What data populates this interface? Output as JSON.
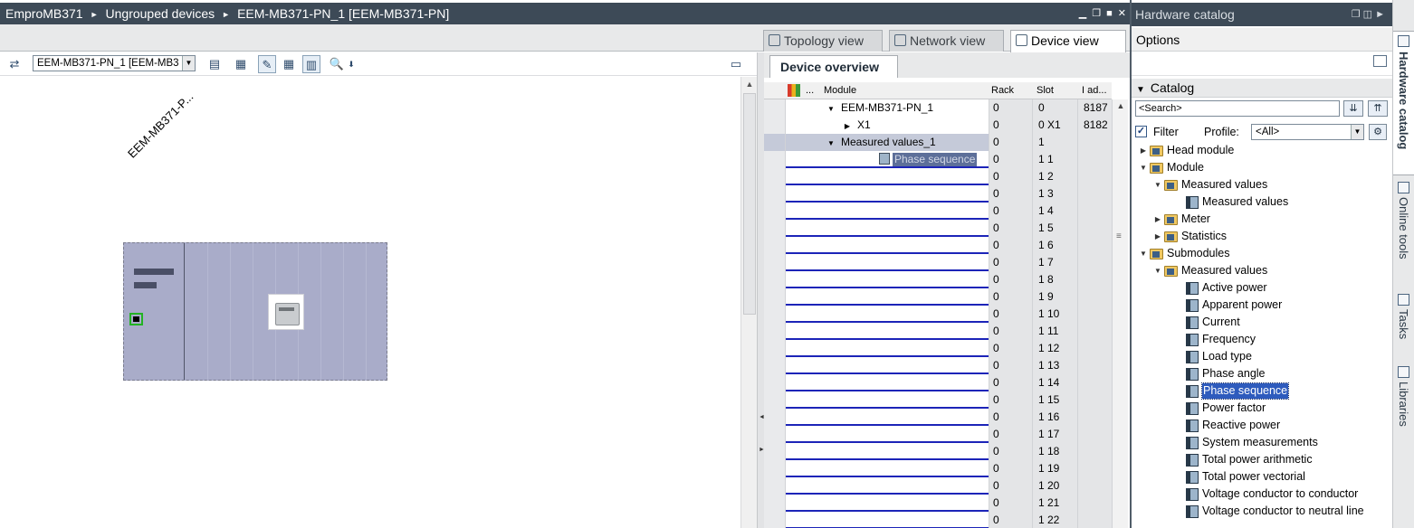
{
  "title_bar": {
    "crumbs": [
      "EmproMB371",
      "Ungrouped devices",
      "EEM-MB371-PN_1 [EEM-MB371-PN]"
    ]
  },
  "view_tabs": [
    {
      "label": "Topology view",
      "icon": "topology-icon"
    },
    {
      "label": "Network view",
      "icon": "network-icon"
    },
    {
      "label": "Device view",
      "icon": "device-icon"
    }
  ],
  "device_toolbar": {
    "device_select": "EEM-MB371-PN_1 [EEM-MB3"
  },
  "canvas": {
    "device_label": "EEM-MB371-P..."
  },
  "device_overview": {
    "tab_label": "Device overview",
    "columns": {
      "dots": "...",
      "module": "Module",
      "rack": "Rack",
      "slot": "Slot",
      "iaddr": "I ad..."
    },
    "rows": [
      {
        "module": "EEM-MB371-PN_1",
        "expand": "down",
        "indent": 1,
        "rack": "0",
        "slot": "0",
        "iaddr": "8187"
      },
      {
        "module": "X1",
        "expand": "right",
        "indent": 2,
        "rack": "0",
        "slot": "0 X1",
        "iaddr": "8182"
      },
      {
        "module": "Measured values_1",
        "expand": "down",
        "indent": 1,
        "rack": "0",
        "slot": "1",
        "iaddr": ""
      },
      {
        "module": "Phase sequence",
        "expand": "",
        "indent": 3,
        "rack": "0",
        "slot": "1 1",
        "iaddr": "",
        "sub": true
      },
      {
        "module": "",
        "rack": "0",
        "slot": "1 2"
      },
      {
        "module": "",
        "rack": "0",
        "slot": "1 3"
      },
      {
        "module": "",
        "rack": "0",
        "slot": "1 4"
      },
      {
        "module": "",
        "rack": "0",
        "slot": "1 5"
      },
      {
        "module": "",
        "rack": "0",
        "slot": "1 6"
      },
      {
        "module": "",
        "rack": "0",
        "slot": "1 7"
      },
      {
        "module": "",
        "rack": "0",
        "slot": "1 8"
      },
      {
        "module": "",
        "rack": "0",
        "slot": "1 9"
      },
      {
        "module": "",
        "rack": "0",
        "slot": "1 10"
      },
      {
        "module": "",
        "rack": "0",
        "slot": "1 11"
      },
      {
        "module": "",
        "rack": "0",
        "slot": "1 12"
      },
      {
        "module": "",
        "rack": "0",
        "slot": "1 13"
      },
      {
        "module": "",
        "rack": "0",
        "slot": "1 14"
      },
      {
        "module": "",
        "rack": "0",
        "slot": "1 15"
      },
      {
        "module": "",
        "rack": "0",
        "slot": "1 16"
      },
      {
        "module": "",
        "rack": "0",
        "slot": "1 17"
      },
      {
        "module": "",
        "rack": "0",
        "slot": "1 18"
      },
      {
        "module": "",
        "rack": "0",
        "slot": "1 19"
      },
      {
        "module": "",
        "rack": "0",
        "slot": "1 20"
      },
      {
        "module": "",
        "rack": "0",
        "slot": "1 21"
      },
      {
        "module": "",
        "rack": "0",
        "slot": "1 22"
      }
    ]
  },
  "catalog": {
    "header": "Hardware catalog",
    "options_label": "Options",
    "catalog_label": "Catalog",
    "search_placeholder": "<Search>",
    "filter_label": "Filter",
    "profile_label": "Profile:",
    "profile_value": "<All>",
    "tree": [
      {
        "label": "Head module",
        "level": 0,
        "type": "folder",
        "expand": "right"
      },
      {
        "label": "Module",
        "level": 0,
        "type": "folder",
        "expand": "down"
      },
      {
        "label": "Measured values",
        "level": 1,
        "type": "folder",
        "expand": "down"
      },
      {
        "label": "Measured values",
        "level": 2,
        "type": "module",
        "expand": ""
      },
      {
        "label": "Meter",
        "level": 1,
        "type": "folder",
        "expand": "right"
      },
      {
        "label": "Statistics",
        "level": 1,
        "type": "folder",
        "expand": "right"
      },
      {
        "label": "Submodules",
        "level": 0,
        "type": "folder",
        "expand": "down"
      },
      {
        "label": "Measured values",
        "level": 1,
        "type": "folder",
        "expand": "down"
      },
      {
        "label": "Active power",
        "level": 2,
        "type": "module",
        "expand": ""
      },
      {
        "label": "Apparent power",
        "level": 2,
        "type": "module",
        "expand": ""
      },
      {
        "label": "Current",
        "level": 2,
        "type": "module",
        "expand": ""
      },
      {
        "label": "Frequency",
        "level": 2,
        "type": "module",
        "expand": ""
      },
      {
        "label": "Load type",
        "level": 2,
        "type": "module",
        "expand": ""
      },
      {
        "label": "Phase angle",
        "level": 2,
        "type": "module",
        "expand": ""
      },
      {
        "label": "Phase sequence",
        "level": 2,
        "type": "module",
        "expand": "",
        "selected": true
      },
      {
        "label": "Power factor",
        "level": 2,
        "type": "module",
        "expand": ""
      },
      {
        "label": "Reactive power",
        "level": 2,
        "type": "module",
        "expand": ""
      },
      {
        "label": "System measurements",
        "level": 2,
        "type": "module",
        "expand": ""
      },
      {
        "label": "Total power arithmetic",
        "level": 2,
        "type": "module",
        "expand": ""
      },
      {
        "label": "Total power vectorial",
        "level": 2,
        "type": "module",
        "expand": ""
      },
      {
        "label": "Voltage conductor to conductor",
        "level": 2,
        "type": "module",
        "expand": ""
      },
      {
        "label": "Voltage conductor to neutral line",
        "level": 2,
        "type": "module",
        "expand": ""
      }
    ]
  },
  "side_tabs": [
    {
      "label": "Hardware catalog",
      "icon": "catalog-icon",
      "active": true
    },
    {
      "label": "Online tools",
      "icon": "online-tools-icon"
    },
    {
      "label": "Tasks",
      "icon": "tasks-icon"
    },
    {
      "label": "Libraries",
      "icon": "libraries-icon"
    }
  ],
  "colors": {
    "title_bar": "#3d4a57",
    "selection": "#2e5bbd",
    "device_body": "#a9acc9",
    "slot_line": "#1c24b8",
    "port_border": "#23b323"
  }
}
